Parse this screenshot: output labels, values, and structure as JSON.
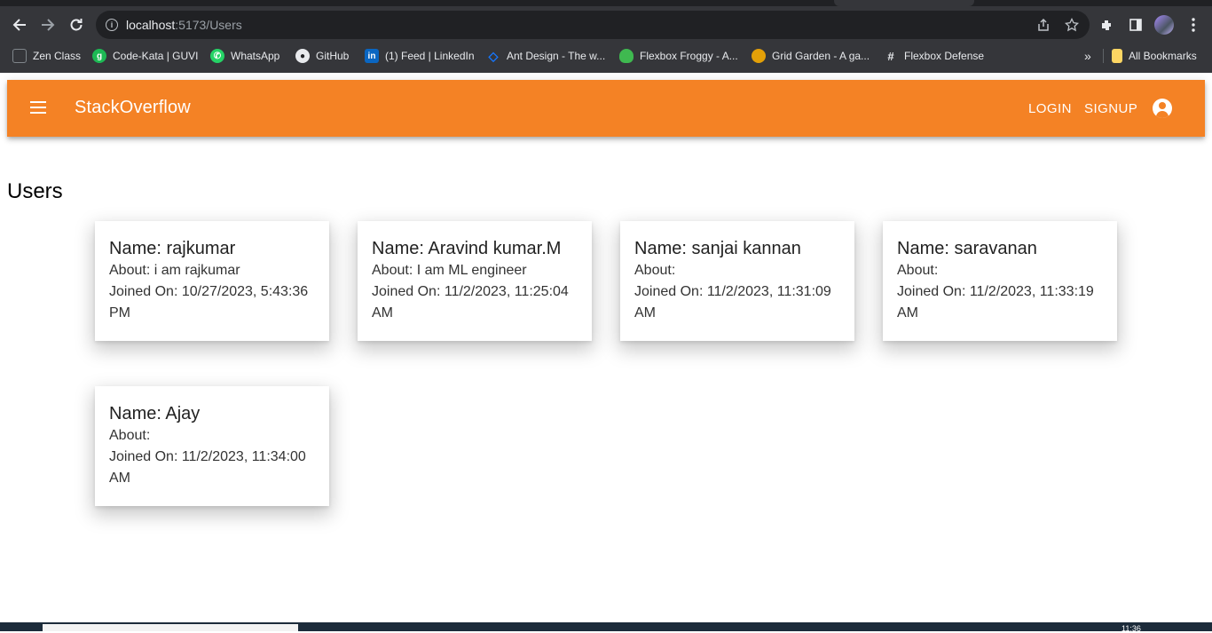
{
  "browser": {
    "url_host": "localhost",
    "url_path": ":5173/Users",
    "bookmarks": [
      {
        "label": "Zen Class",
        "icon": "document-icon",
        "color": "#3c4043"
      },
      {
        "label": "Code-Kata | GUVI",
        "icon": "guvi-icon",
        "color": "#1db954"
      },
      {
        "label": "WhatsApp",
        "icon": "whatsapp-icon",
        "color": "#25d366"
      },
      {
        "label": "GitHub",
        "icon": "github-icon",
        "color": "#24292e"
      },
      {
        "label": "(1) Feed | LinkedIn",
        "icon": "linkedin-icon",
        "color": "#0a66c2"
      },
      {
        "label": "Ant Design - The w...",
        "icon": "ant-design-icon",
        "color": "#1677ff"
      },
      {
        "label": "Flexbox Froggy - A...",
        "icon": "froggy-icon",
        "color": "#3fb950"
      },
      {
        "label": "Grid Garden - A ga...",
        "icon": "grid-garden-icon",
        "color": "#e3a008"
      },
      {
        "label": "Flexbox Defense",
        "icon": "flexbox-defense-icon",
        "color": "#202124"
      }
    ],
    "all_bookmarks": "All Bookmarks",
    "overflow": "»"
  },
  "app": {
    "brand": "StackOverflow",
    "accent": "#f48225",
    "login": "LOGIN",
    "signup": "SIGNUP"
  },
  "page": {
    "title": "Users"
  },
  "users": [
    {
      "name": "Name: rajkumar",
      "about": "About: i am rajkumar",
      "joined": "Joined On: 10/27/2023, 5:43:36 PM"
    },
    {
      "name": "Name: Aravind kumar.M",
      "about": "About: I am ML engineer",
      "joined": "Joined On: 11/2/2023, 11:25:04 AM"
    },
    {
      "name": "Name: sanjai kannan",
      "about": "About:",
      "joined": "Joined On: 11/2/2023, 11:31:09 AM"
    },
    {
      "name": "Name: saravanan",
      "about": "About:",
      "joined": "Joined On: 11/2/2023, 11:33:19 AM"
    },
    {
      "name": "Name: Ajay",
      "about": "About:",
      "joined": "Joined On: 11/2/2023, 11:34:00 AM"
    }
  ],
  "taskbar": {
    "clock": "11:36"
  }
}
